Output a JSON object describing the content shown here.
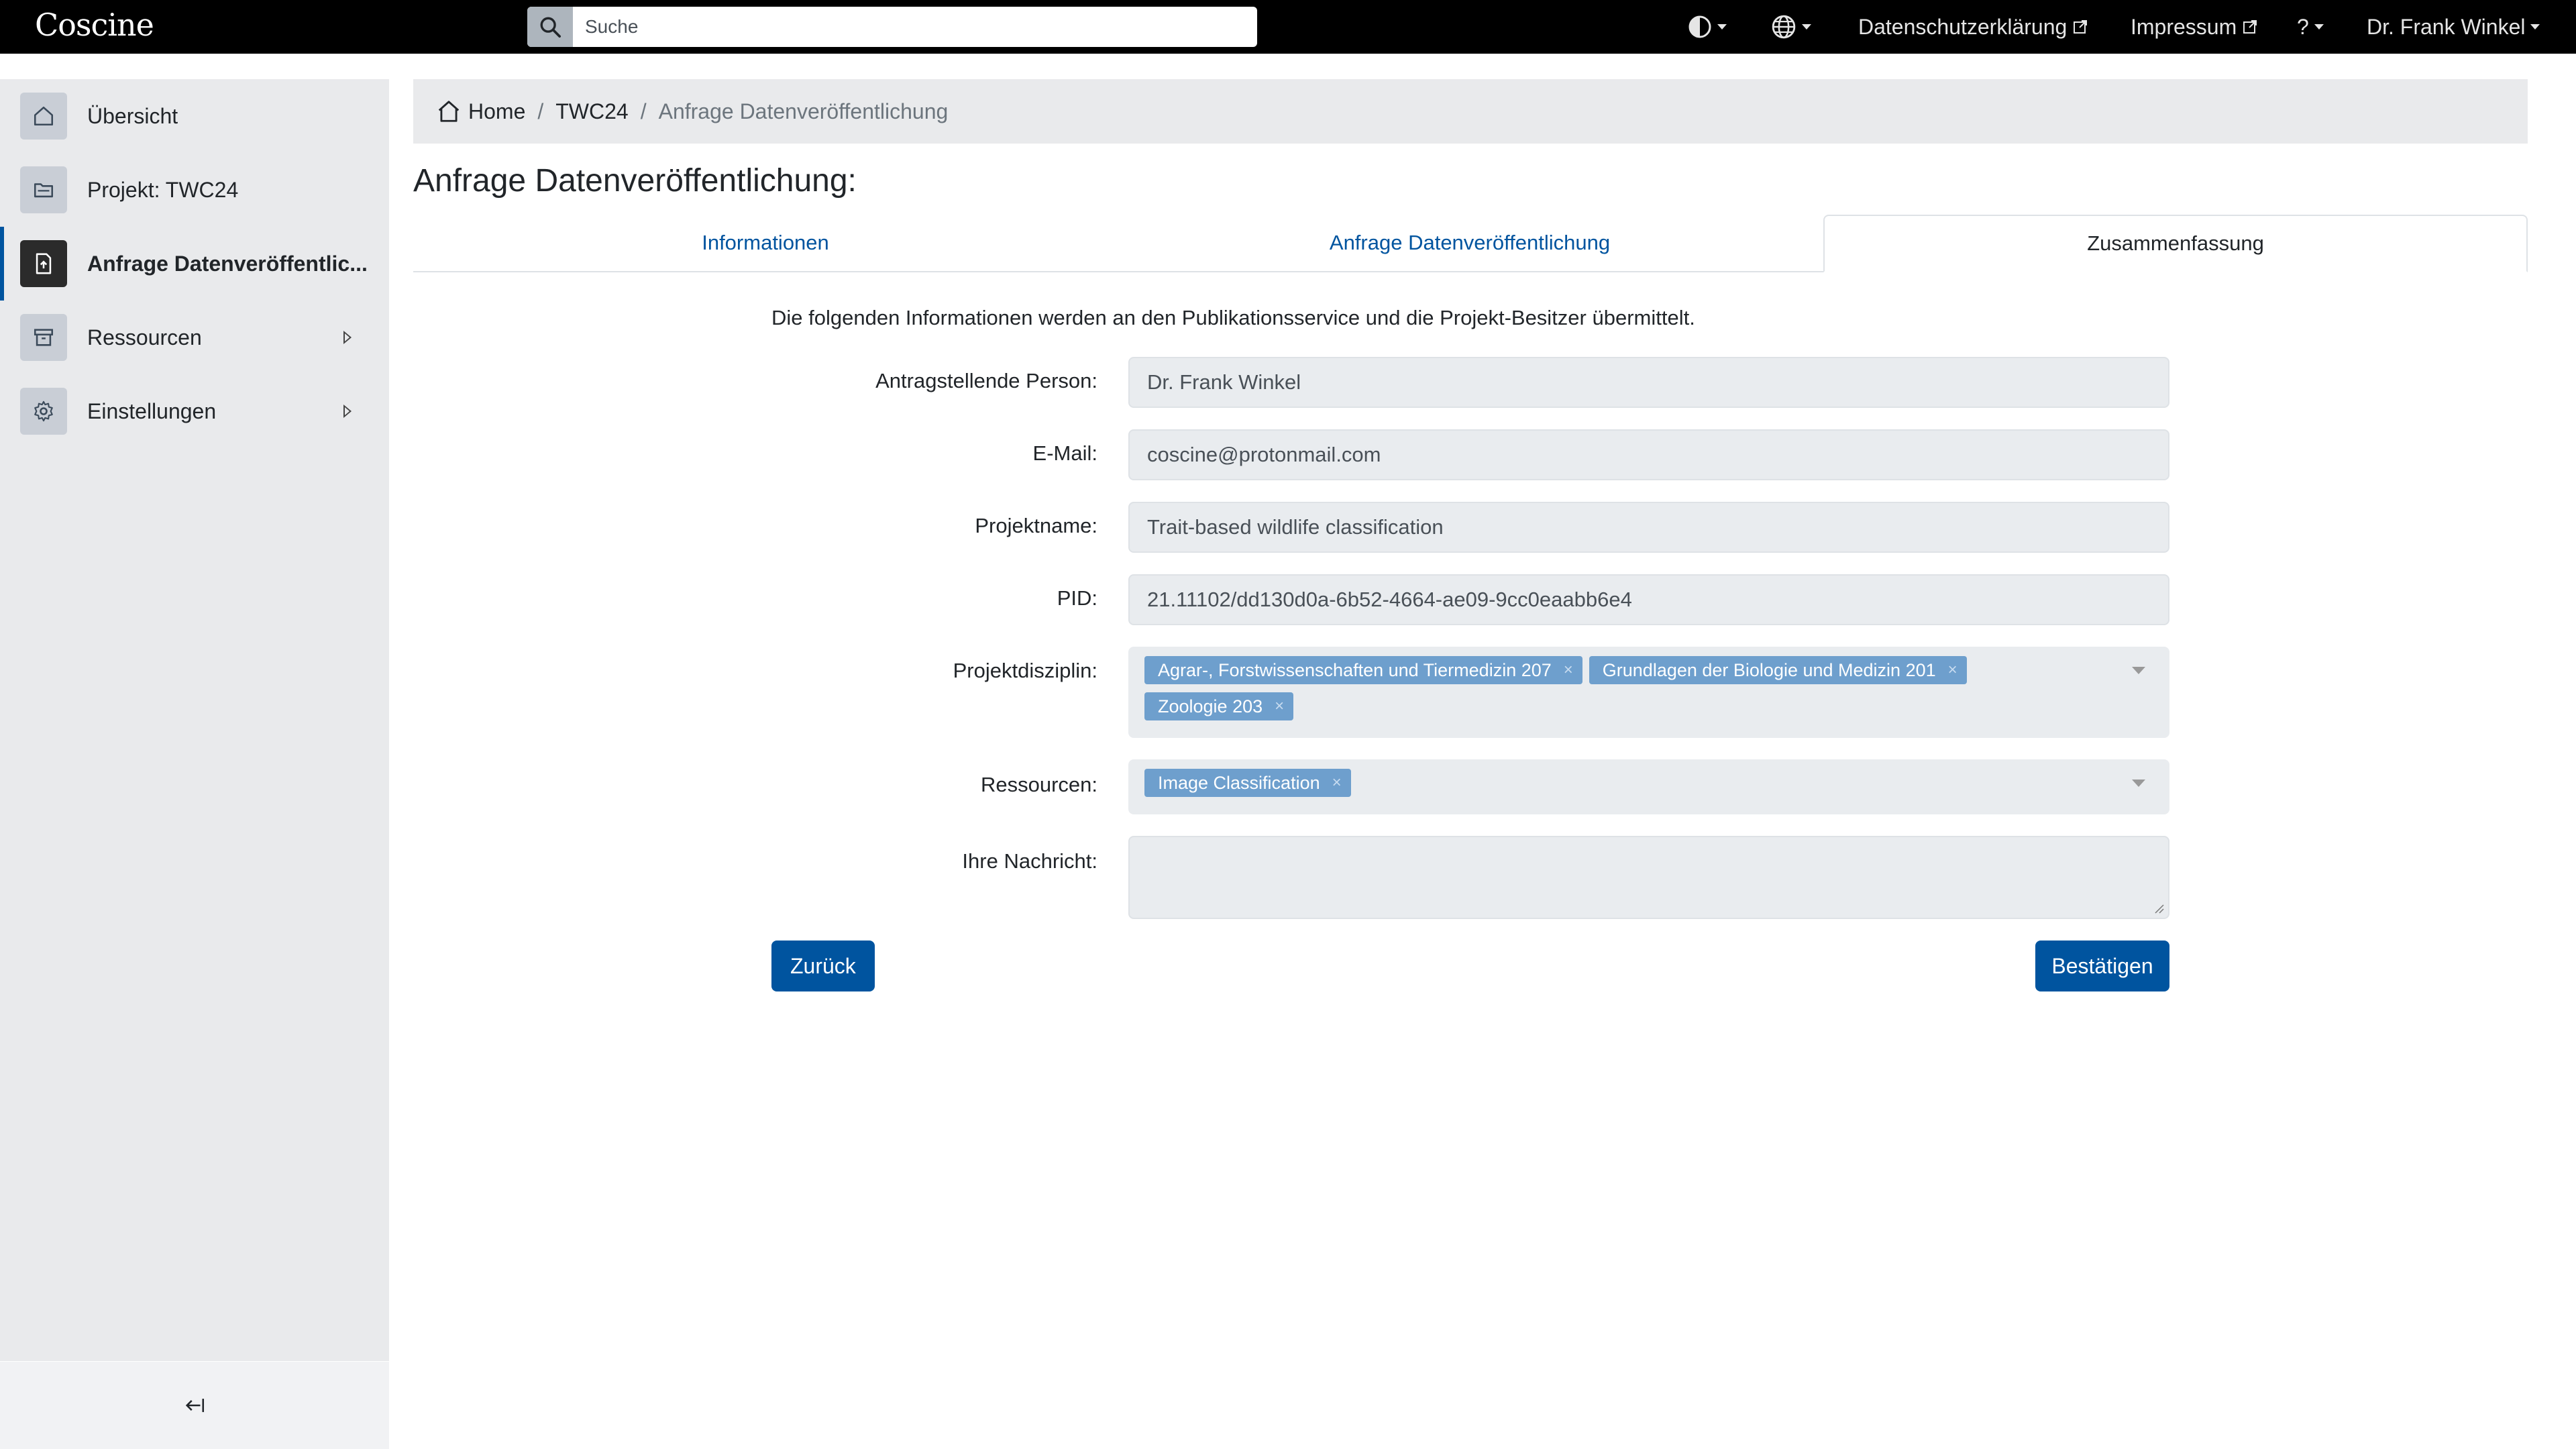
{
  "app": {
    "logo": "Coscine"
  },
  "search": {
    "placeholder": "Suche"
  },
  "topnav": {
    "privacy": "Datenschutzerklärung",
    "imprint": "Impressum",
    "help": "?",
    "user": "Dr. Frank Winkel"
  },
  "sidebar": {
    "items": [
      {
        "label": "Übersicht",
        "icon": "home-icon"
      },
      {
        "label": "Projekt: TWC24",
        "icon": "folder-icon"
      },
      {
        "label": "Anfrage Datenveröffentlic...",
        "icon": "file-upload-icon"
      },
      {
        "label": "Ressourcen",
        "icon": "archive-icon"
      },
      {
        "label": "Einstellungen",
        "icon": "gear-icon"
      }
    ],
    "collapse_icon": "collapse-left-icon"
  },
  "breadcrumb": {
    "home": "Home",
    "sep": "/",
    "project": "TWC24",
    "current": "Anfrage Datenveröffentlichung"
  },
  "page": {
    "title": "Anfrage Datenveröffentlichung:"
  },
  "tabs": [
    {
      "label": "Informationen"
    },
    {
      "label": "Anfrage Datenveröffentlichung"
    },
    {
      "label": "Zusammenfassung"
    }
  ],
  "form": {
    "intro": "Die folgenden Informationen werden an den Publikationsservice und die Projekt-Besitzer übermittelt.",
    "applicant": {
      "label": "Antragstellende Person:",
      "value": "Dr. Frank Winkel"
    },
    "email": {
      "label": "E-Mail:",
      "value": "coscine@protonmail.com"
    },
    "project_name": {
      "label": "Projektname:",
      "value": "Trait-based wildlife classification"
    },
    "pid": {
      "label": "PID:",
      "value": "21.11102/dd130d0a-6b52-4664-ae09-9cc0eaabb6e4"
    },
    "discipline": {
      "label": "Projektdisziplin:",
      "tags": [
        "Agrar-, Forstwissenschaften und Tiermedizin 207",
        "Grundlagen der Biologie und Medizin 201",
        "Zoologie 203"
      ]
    },
    "resources": {
      "label": "Ressourcen:",
      "tags": [
        "Image Classification"
      ]
    },
    "message": {
      "label": "Ihre Nachricht:",
      "value": ""
    },
    "tag_remove": "×"
  },
  "buttons": {
    "back": "Zurück",
    "confirm": "Bestätigen"
  },
  "colors": {
    "accent": "#00549f",
    "tag": "#6e9fcd",
    "topbar": "#000000"
  }
}
